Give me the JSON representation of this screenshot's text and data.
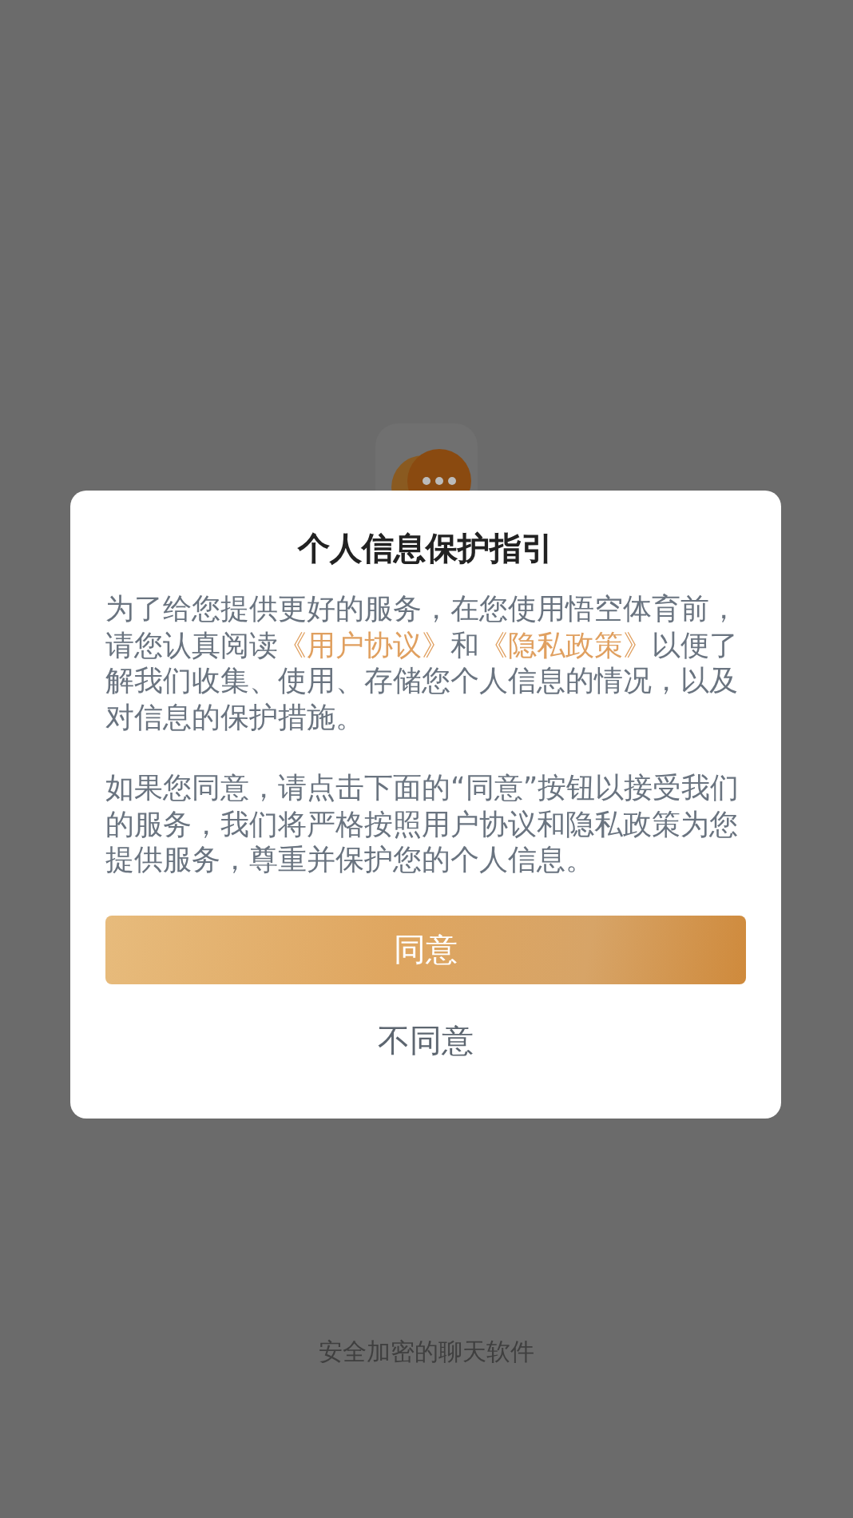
{
  "footer": "安全加密的聊天软件",
  "dialog": {
    "title": "个人信息保护指引",
    "paragraphs": [
      [
        {
          "kind": "text",
          "text": "为了给您提供更好的服务，在您使用悟空体育前，请您认真阅读"
        },
        {
          "kind": "link",
          "text": "《用户协议》"
        },
        {
          "kind": "text",
          "text": "和"
        },
        {
          "kind": "link",
          "text": "《隐私政策》"
        },
        {
          "kind": "text",
          "text": "以便了解我们收集、使用、存储您个人信息的情况，以及对信息的保护措施。"
        }
      ],
      [
        {
          "kind": "text",
          "text": "如果您同意，请点击下面的“同意”按钮以接受我们的服务，我们将严格按照用户协议和隐私政策为您提供服务，尊重并保护您的个人信息。"
        }
      ]
    ],
    "agree": "同意",
    "disagree": "不同意"
  }
}
